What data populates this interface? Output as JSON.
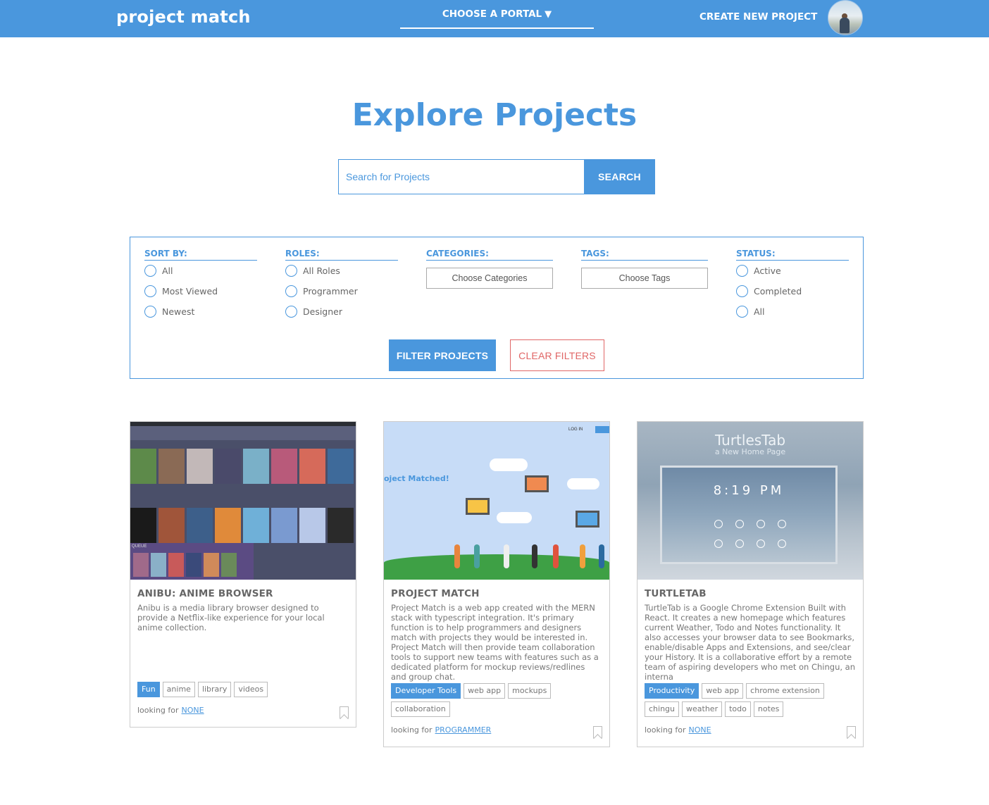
{
  "header": {
    "brand": "project match",
    "portal_label": "CHOOSE A PORTAL",
    "portal_caret": "▼",
    "create_label": "CREATE NEW PROJECT"
  },
  "main": {
    "title": "Explore Projects",
    "search_placeholder": "Search for Projects",
    "search_button": "SEARCH"
  },
  "filters": {
    "sort": {
      "heading": "SORT BY:",
      "options": [
        "All",
        "Most Viewed",
        "Newest"
      ]
    },
    "roles": {
      "heading": "ROLES:",
      "options": [
        "All Roles",
        "Programmer",
        "Designer"
      ]
    },
    "categories": {
      "heading": "CATEGORIES:",
      "button": "Choose Categories"
    },
    "tags": {
      "heading": "TAGS:",
      "button": "Choose Tags"
    },
    "status": {
      "heading": "STATUS:",
      "options": [
        "Active",
        "Completed",
        "All"
      ]
    },
    "filter_button": "FILTER PROJECTS",
    "clear_button": "CLEAR FILTERS"
  },
  "projects": [
    {
      "title": "ANIBU: ANIME BROWSER",
      "description": "Anibu is a media library browser designed to provide a Netflix-like experience for your local anime collection.",
      "category": "Fun",
      "tags": [
        "anime",
        "library",
        "videos"
      ],
      "looking_for_label": "looking for",
      "looking_for": "NONE"
    },
    {
      "title": "PROJECT MATCH",
      "description": "Project Match is a web app created with the MERN stack with typescript integration. It's primary function is to help programmers and designers match with projects they would be interested in. Project Match will then provide team collaboration tools to support new teams with features such as a dedicated platform for mockup reviews/redlines and group chat.",
      "category": "Developer Tools",
      "tags": [
        "web app",
        "mockups",
        "collaboration"
      ],
      "looking_for_label": "looking for",
      "looking_for": "PROGRAMMER"
    },
    {
      "title": "TURTLETAB",
      "description": "TurtleTab is a Google Chrome Extension Built with React. It creates a new homepage which features current Weather, Todo and Notes functionality. It also accesses your browser data to see Bookmarks, enable/disable Apps and Extensions, and see/clear your History. It is a collaborative effort by a remote team of aspiring developers who met on Chingu, an interna",
      "category": "Productivity",
      "tags": [
        "web app",
        "chrome extension",
        "chingu",
        "weather",
        "todo",
        "notes"
      ],
      "looking_for_label": "looking for",
      "looking_for": "NONE"
    }
  ],
  "thumbnails": {
    "anibu": {
      "queue_label": "QUEUE"
    },
    "project_match": {
      "heading": "oject Matched!",
      "login": "LOG IN"
    },
    "turtletab": {
      "title": "TurtlesTab",
      "subtitle": "a New Home Page",
      "clock": "8:19 PM"
    }
  },
  "colors": {
    "brand_blue": "#4a97dd",
    "clear_red": "#e06666",
    "border_grey": "#cccccc"
  }
}
